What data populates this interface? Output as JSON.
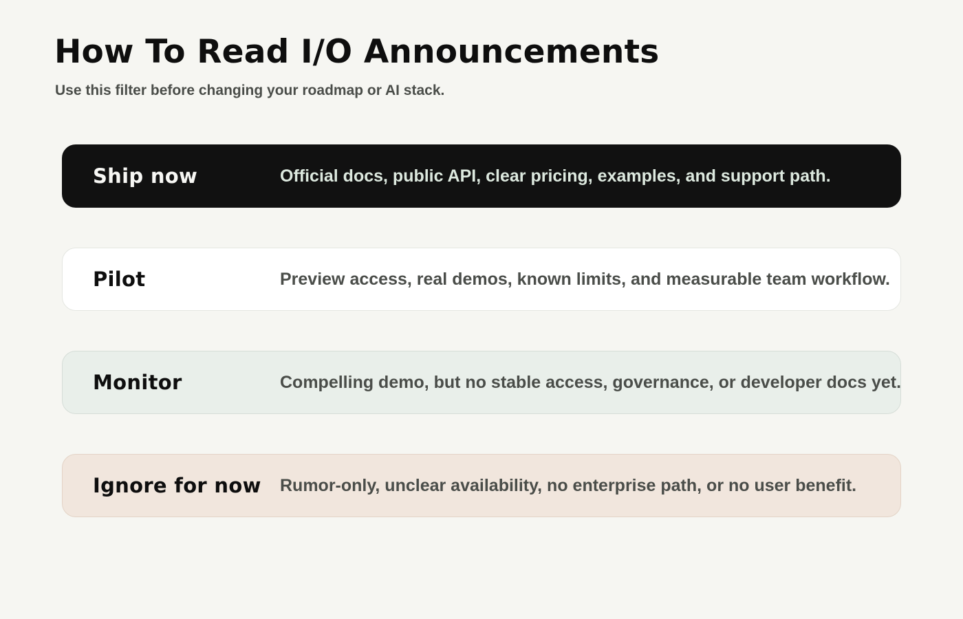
{
  "page": {
    "title": "How To Read I/O Announcements",
    "subtitle": "Use this filter before changing your roadmap or AI stack."
  },
  "cards": [
    {
      "label": "Ship now",
      "description": "Official docs, public API, clear pricing, examples, and support path.",
      "background": "#111111",
      "text_color": "#f7f7f4"
    },
    {
      "label": "Pilot",
      "description": "Preview access, real demos, known limits, and measurable team workflow.",
      "background": "#ffffff",
      "text_color": "#0e0e0e"
    },
    {
      "label": "Monitor",
      "description": "Compelling demo, but no stable access, governance, or developer docs yet.",
      "background": "#e9efea",
      "text_color": "#0e0e0e"
    },
    {
      "label": "Ignore for now",
      "description": "Rumor-only, unclear availability, no enterprise path, or no user benefit.",
      "background": "#f1e6dd",
      "text_color": "#0e0e0e"
    }
  ]
}
